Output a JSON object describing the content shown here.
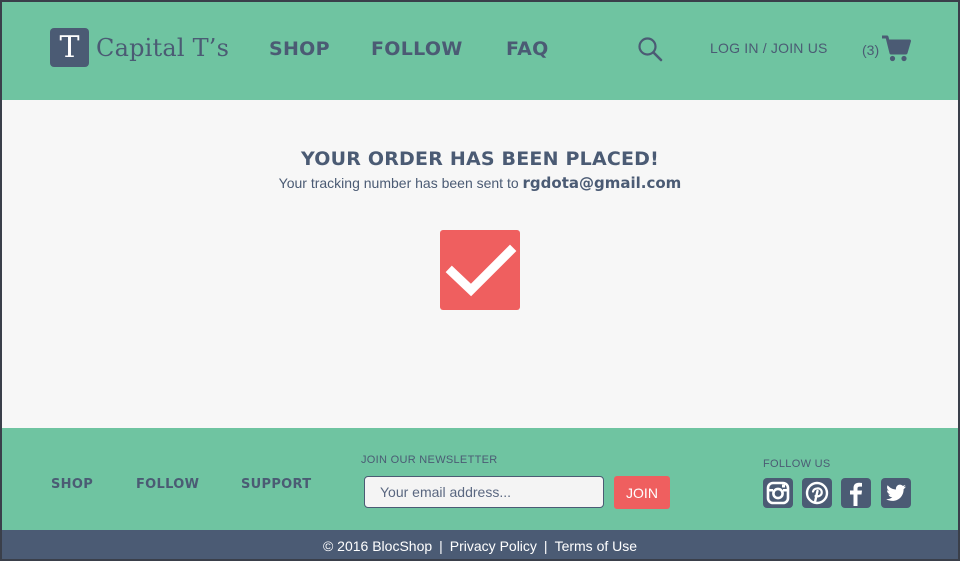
{
  "header": {
    "logo_letter": "T",
    "brand": "Capital T’s",
    "nav": [
      "SHOP",
      "FOLLOW",
      "FAQ"
    ],
    "login_label": "LOG IN / JOIN US",
    "cart_count": "(3)"
  },
  "main": {
    "title": "YOUR ORDER HAS BEEN PLACED!",
    "subtitle_prefix": "Your tracking number has been sent to ",
    "email": "rgdota@gmail.com"
  },
  "footer": {
    "links": [
      "SHOP",
      "FOLLOW",
      "SUPPORT"
    ],
    "newsletter_label": "JOIN OUR NEWSLETTER",
    "email_placeholder": "Your email address...",
    "join_label": "JOIN",
    "follow_label": "FOLLOW US",
    "social_icons": [
      "instagram-icon",
      "pinterest-icon",
      "facebook-icon",
      "twitter-icon"
    ]
  },
  "bottom_bar": {
    "copyright": "© 2016 BlocShop",
    "privacy": "Privacy Policy",
    "terms": "Terms of Use"
  },
  "colors": {
    "green": "#6fc4a1",
    "navy": "#4b5b74",
    "accent_red": "#ef5f5f",
    "background": "#f7f7f7"
  }
}
